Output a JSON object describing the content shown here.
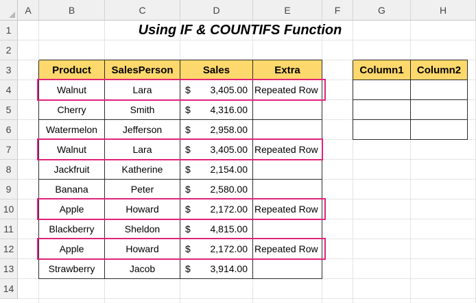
{
  "columns": [
    "A",
    "B",
    "C",
    "D",
    "E",
    "F",
    "G",
    "H"
  ],
  "rows": [
    "1",
    "2",
    "3",
    "4",
    "5",
    "6",
    "7",
    "8",
    "9",
    "10",
    "11",
    "12",
    "13",
    "14"
  ],
  "title": "Using IF & COUNTIFS Function",
  "table": {
    "headers": [
      "Product",
      "SalesPerson",
      "Sales",
      "Extra"
    ],
    "currency": "$",
    "records": [
      {
        "product": "Walnut",
        "person": "Lara",
        "sales": "3,405.00",
        "extra": "Repeated Row"
      },
      {
        "product": "Cherry",
        "person": "Smith",
        "sales": "4,316.00",
        "extra": ""
      },
      {
        "product": "Watermelon",
        "person": "Jefferson",
        "sales": "2,958.00",
        "extra": ""
      },
      {
        "product": "Walnut",
        "person": "Lara",
        "sales": "3,405.00",
        "extra": "Repeated Row"
      },
      {
        "product": "Jackfruit",
        "person": "Katherine",
        "sales": "2,154.00",
        "extra": ""
      },
      {
        "product": "Banana",
        "person": "Peter",
        "sales": "2,580.00",
        "extra": ""
      },
      {
        "product": "Apple",
        "person": "Howard",
        "sales": "2,172.00",
        "extra": "Repeated Row"
      },
      {
        "product": "Blackberry",
        "person": "Sheldon",
        "sales": "4,815.00",
        "extra": ""
      },
      {
        "product": "Apple",
        "person": "Howard",
        "sales": "2,172.00",
        "extra": "Repeated Row"
      },
      {
        "product": "Strawberry",
        "person": "Jacob",
        "sales": "3,914.00",
        "extra": ""
      }
    ]
  },
  "side_table": {
    "headers": [
      "Column1",
      "Column2"
    ]
  },
  "colors": {
    "header_fill": "#fdd86c",
    "highlight_border": "#e0227a"
  }
}
